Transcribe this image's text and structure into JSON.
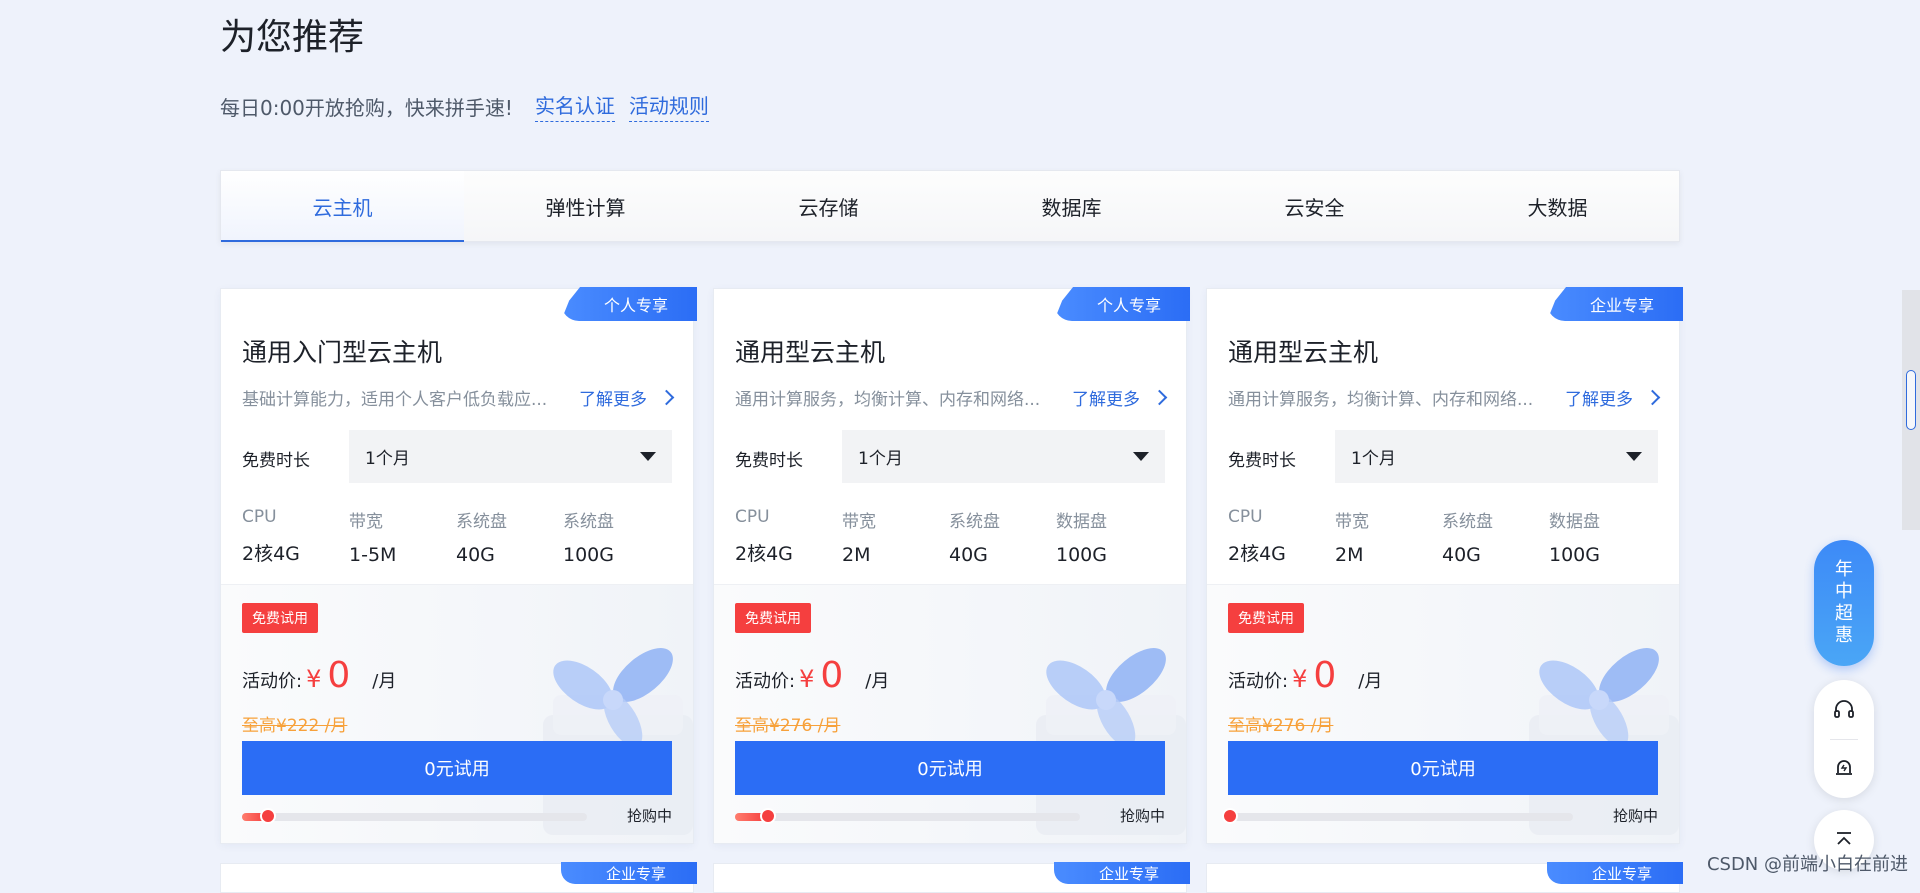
{
  "page": {
    "title": "为您推荐",
    "subtitle": "每日0:00开放抢购，快来拼手速!",
    "links": [
      "实名认证",
      "活动规则"
    ]
  },
  "tabs": [
    {
      "label": "云主机",
      "active": true
    },
    {
      "label": "弹性计算",
      "active": false
    },
    {
      "label": "云存储",
      "active": false
    },
    {
      "label": "数据库",
      "active": false
    },
    {
      "label": "云安全",
      "active": false
    },
    {
      "label": "大数据",
      "active": false
    }
  ],
  "cards": [
    {
      "badge": "个人专享",
      "title": "通用入门型云主机",
      "desc": "基础计算能力，适用个人客户低负载应...",
      "more": "了解更多",
      "duration_label": "免费时长",
      "duration_value": "1个月",
      "specs": [
        {
          "label": "CPU",
          "value": "2核4G"
        },
        {
          "label": "带宽",
          "value": "1-5M"
        },
        {
          "label": "系统盘",
          "value": "40G"
        },
        {
          "label": "系统盘",
          "value": "100G"
        }
      ],
      "tag": "免费试用",
      "price_label": "活动价:",
      "currency": "¥",
      "price": "0",
      "unit": "/月",
      "original": "至高¥222 /月",
      "cta": "0元试用",
      "progress": 0.07,
      "status": "抢购中"
    },
    {
      "badge": "个人专享",
      "title": "通用型云主机",
      "desc": "通用计算服务，均衡计算、内存和网络...",
      "more": "了解更多",
      "duration_label": "免费时长",
      "duration_value": "1个月",
      "specs": [
        {
          "label": "CPU",
          "value": "2核4G"
        },
        {
          "label": "带宽",
          "value": "2M"
        },
        {
          "label": "系统盘",
          "value": "40G"
        },
        {
          "label": "数据盘",
          "value": "100G"
        }
      ],
      "tag": "免费试用",
      "price_label": "活动价:",
      "currency": "¥",
      "price": "0",
      "unit": "/月",
      "original": "至高¥276 /月",
      "cta": "0元试用",
      "progress": 0.09,
      "status": "抢购中"
    },
    {
      "badge": "企业专享",
      "title": "通用型云主机",
      "desc": "通用计算服务，均衡计算、内存和网络...",
      "more": "了解更多",
      "duration_label": "免费时长",
      "duration_value": "1个月",
      "specs": [
        {
          "label": "CPU",
          "value": "2核4G"
        },
        {
          "label": "带宽",
          "value": "2M"
        },
        {
          "label": "系统盘",
          "value": "40G"
        },
        {
          "label": "数据盘",
          "value": "100G"
        }
      ],
      "tag": "免费试用",
      "price_label": "活动价:",
      "currency": "¥",
      "price": "0",
      "unit": "/月",
      "original": "至高¥276 /月",
      "cta": "0元试用",
      "progress": 0.0,
      "status": "抢购中"
    }
  ],
  "next_row_badges": [
    "企业专享",
    "企业专享",
    "企业专享"
  ],
  "side": {
    "promo_chars": [
      "年",
      "中",
      "超",
      "惠"
    ]
  },
  "watermark": "CSDN @前端小白在前进",
  "colors": {
    "accent": "#2b6df5",
    "price": "#f53f3f",
    "original_price": "#f7a13a",
    "page_bg": "#eef2fb"
  }
}
